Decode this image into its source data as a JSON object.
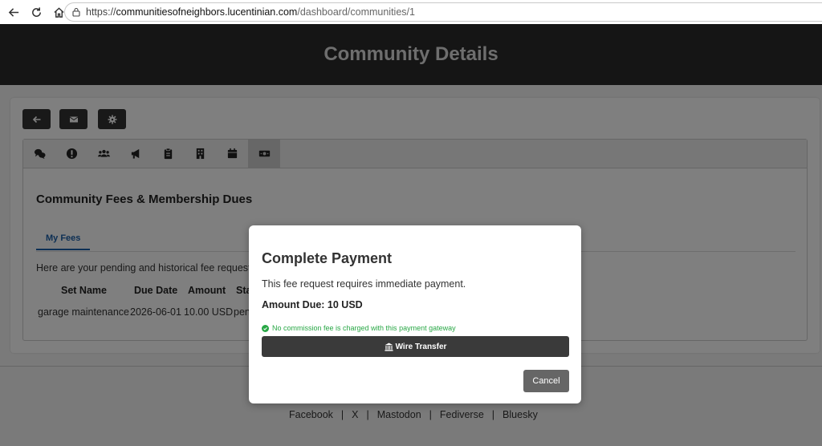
{
  "browser": {
    "url_protocol": "https://",
    "url_host": "communitiesofneighbors.lucentinian.com",
    "url_path": "/dashboard/communities/1"
  },
  "header": {
    "title": "Community Details"
  },
  "toolbar": {
    "buttons": [
      {
        "icon": "arrow-left-icon"
      },
      {
        "icon": "envelope-icon"
      },
      {
        "icon": "gear-icon"
      }
    ]
  },
  "icon_tabs": [
    {
      "icon": "comments-icon"
    },
    {
      "icon": "exclamation-circle-icon"
    },
    {
      "icon": "users-icon"
    },
    {
      "icon": "bullhorn-icon"
    },
    {
      "icon": "clipboard-icon"
    },
    {
      "icon": "building-icon"
    },
    {
      "icon": "calendar-icon"
    },
    {
      "icon": "money-bill-icon",
      "active": true
    }
  ],
  "fees": {
    "title": "Community Fees & Membership Dues",
    "tab_label": "My Fees",
    "intro": "Here are your pending and historical fee requests",
    "columns": [
      "Set Name",
      "Due Date",
      "Amount",
      "Sta"
    ],
    "rows": [
      {
        "set_name": "garage maintenance",
        "due_date": "2026-06-01",
        "amount": "10.00 USD",
        "status": "pen"
      }
    ]
  },
  "footer": {
    "links": [
      "Facebook",
      "X",
      "Mastodon",
      "Fediverse",
      "Bluesky"
    ],
    "separator": "|"
  },
  "modal": {
    "title": "Complete Payment",
    "description": "This fee request requires immediate payment.",
    "amount_due": "Amount Due: 10 USD",
    "commission_note": "No commission fee is charged with this payment gateway",
    "wire_button": "Wire Transfer",
    "cancel_button": "Cancel"
  },
  "colors": {
    "header_bg": "#2a2a2a",
    "accent_blue": "#1a5fa8",
    "success_green": "#28a745",
    "button_dark": "#333333",
    "cancel_gray": "#666666"
  }
}
